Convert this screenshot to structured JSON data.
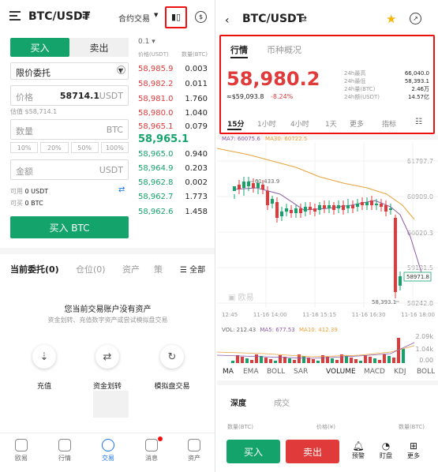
{
  "left": {
    "pair": "BTC/USDT",
    "contract_label": "合约交易",
    "buy_tab": "买入",
    "sell_tab": "卖出",
    "order_type": "限价委托",
    "price_label": "价格",
    "price_value": "58714.1",
    "price_unit": "USDT",
    "estimate": "估值 $58,714.1",
    "qty_label": "数量",
    "qty_unit": "BTC",
    "percents": [
      "10%",
      "20%",
      "50%",
      "100%"
    ],
    "amount_label": "金额",
    "amount_unit": "USDT",
    "avail_label": "可用",
    "avail_usdt": "0 USDT",
    "canbuy_label": "可买",
    "canbuy_btc": "0 BTC",
    "buy_button": "买入 BTC",
    "depth_step": "0.1",
    "ob_header_price": "价格(USDT)",
    "ob_header_qty": "数量(BTC)",
    "asks": [
      {
        "p": "58,985.9",
        "q": "0.003"
      },
      {
        "p": "58,982.2",
        "q": "0.011"
      },
      {
        "p": "58,981.0",
        "q": "1.760"
      },
      {
        "p": "58,980.0",
        "q": "1.040"
      },
      {
        "p": "58,965.1",
        "q": "0.079"
      }
    ],
    "mid_price": "58,965.1",
    "bids": [
      {
        "p": "58,965.0",
        "q": "0.940"
      },
      {
        "p": "58,964.9",
        "q": "0.203"
      },
      {
        "p": "58,962.8",
        "q": "0.002"
      },
      {
        "p": "58,962.7",
        "q": "1.773"
      },
      {
        "p": "58,962.6",
        "q": "1.458"
      }
    ],
    "tabs": [
      "当前委托(0)",
      "仓位(0)",
      "资产",
      "策",
      "全部"
    ],
    "empty_title": "您当前交易账户没有资产",
    "empty_sub": "资金划转、充值数字资产或尝试模拟盘交易",
    "actions": [
      "充值",
      "资金划转",
      "模拟盘交易"
    ],
    "nav": [
      "欧易",
      "行情",
      "交易",
      "消息",
      "资产"
    ]
  },
  "right": {
    "pair": "BTC/USDT",
    "tabs": [
      "行情",
      "币种概况"
    ],
    "price": "58,980.2",
    "usd_price": "≈$59,093.8",
    "change": "-8.24%",
    "stats": [
      {
        "k": "24h最高",
        "v": "66,040.0"
      },
      {
        "k": "24h最低",
        "v": "58,393.1"
      },
      {
        "k": "24h量(BTC)",
        "v": "2.46万"
      },
      {
        "k": "24h额(USDT)",
        "v": "14.57亿"
      }
    ],
    "intervals": [
      "15分",
      "1小时",
      "4小时",
      "1天",
      "更多",
      "指标"
    ],
    "ma_line": [
      "MA7: 60075.6",
      "MA30: 60722.5"
    ],
    "y_ticks": [
      "61797.7",
      "60909.0",
      "60020.3",
      "59131.5",
      "58242.8"
    ],
    "x_ticks": [
      "12:45",
      "11-16 14:00",
      "11-16 15:15",
      "11-16 16:30",
      "11-16 18:00"
    ],
    "annot_high": "61,433.9",
    "annot_low": "58,393.1",
    "last_tag": "58971.8",
    "watermark": "欧易",
    "vol_line": [
      "VOL: 212.43",
      "MA5: 677.53",
      "MA10: 412.39"
    ],
    "vol_ticks": [
      "2.09k",
      "1.04k",
      "0.00"
    ],
    "indicators": [
      "MA",
      "EMA",
      "BOLL",
      "SAR",
      "VOLUME",
      "MACD",
      "KDJ",
      "BOLL"
    ],
    "depth_tabs": [
      "深度",
      "成交"
    ],
    "depth_headers": [
      "数量(BTC)",
      "价格(¥)",
      "数量(BTC)"
    ],
    "buy": "买入",
    "sell": "卖出",
    "bottom_icons": [
      "预警",
      "盯盘",
      "更多"
    ]
  },
  "colors": {
    "green": "#15a36c",
    "red": "#e03a3a",
    "accent": "#1a73e8"
  }
}
